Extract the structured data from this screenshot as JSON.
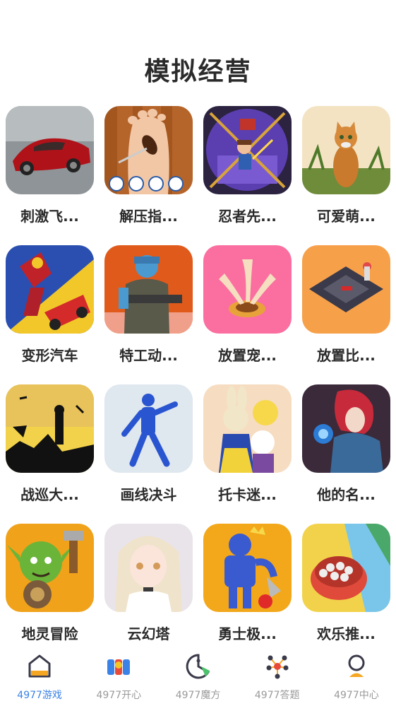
{
  "page_title": "模拟经营",
  "games": [
    {
      "name": "刺激飞...",
      "icon": "red-sports-car-icon"
    },
    {
      "name": "解压指...",
      "icon": "foot-cockroach-icon"
    },
    {
      "name": "忍者先...",
      "icon": "ninja-pin-puzzle-icon"
    },
    {
      "name": "可爱萌...",
      "icon": "cat-icon"
    },
    {
      "name": "变形汽车",
      "icon": "robot-car-icon"
    },
    {
      "name": "特工动...",
      "icon": "agent-soldier-icon"
    },
    {
      "name": "放置宠...",
      "icon": "pet-paws-icon"
    },
    {
      "name": "放置比...",
      "icon": "race-track-icon"
    },
    {
      "name": "战巡大...",
      "icon": "silhouette-war-icon"
    },
    {
      "name": "画线决斗",
      "icon": "blue-mannequin-icon"
    },
    {
      "name": "托卡迷...",
      "icon": "bunny-friends-icon"
    },
    {
      "name": "他的名...",
      "icon": "red-hair-mage-icon"
    },
    {
      "name": "地灵冒险",
      "icon": "goblin-icon"
    },
    {
      "name": "云幻塔",
      "icon": "anime-girl-icon"
    },
    {
      "name": "勇士极...",
      "icon": "blue-robot-icon"
    },
    {
      "name": "欢乐推...",
      "icon": "ball-pusher-icon"
    }
  ],
  "tabs": [
    {
      "label": "4977游戏",
      "icon": "home-icon",
      "active": true
    },
    {
      "label": "4977开心",
      "icon": "happy-m-icon",
      "active": false
    },
    {
      "label": "4977魔方",
      "icon": "pacman-icon",
      "active": false
    },
    {
      "label": "4977答题",
      "icon": "network-nodes-icon",
      "active": false
    },
    {
      "label": "4977中心",
      "icon": "person-icon",
      "active": false
    }
  ],
  "colors": {
    "active_tab": "#3b82e6",
    "inactive_tab": "#9a9a9a",
    "accent_orange": "#f5a623"
  }
}
